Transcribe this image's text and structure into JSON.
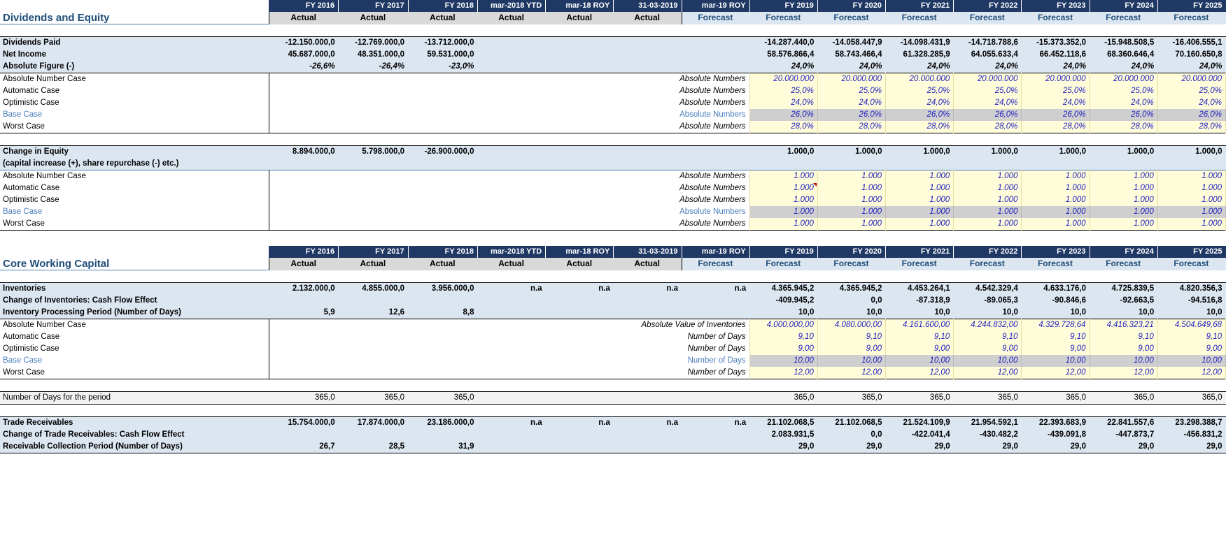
{
  "columns": {
    "years": [
      "FY 2016",
      "FY 2017",
      "FY 2018",
      "mar-2018 YTD",
      "mar-18 ROY",
      "31-03-2019",
      "mar-19 ROY",
      "FY 2019",
      "FY 2020",
      "FY 2021",
      "FY 2022",
      "FY 2023",
      "FY 2024",
      "FY 2025"
    ],
    "types": [
      "Actual",
      "Actual",
      "Actual",
      "Actual",
      "Actual",
      "Actual",
      "Forecast",
      "Forecast",
      "Forecast",
      "Forecast",
      "Forecast",
      "Forecast",
      "Forecast",
      "Forecast"
    ]
  },
  "colors": {
    "header_navy": "#1f3864",
    "actual_grey": "#d9d9d9",
    "forecast_blue": "#dce6f1",
    "accent_text": "#1f4e79",
    "base_case_text": "#4a7ebb",
    "input_yellow": "#fffcd9",
    "input_blue_text": "#1f1fc0",
    "base_case_fill": "#cfcfcf"
  },
  "section1": {
    "title": "Dividends and Equity",
    "rows": [
      {
        "label": "Dividends Paid",
        "values": [
          "-12.150.000,0",
          "-12.769.000,0",
          "-13.712.000,0",
          "",
          "",
          "",
          "",
          "-14.287.440,0",
          "-14.058.447,9",
          "-14.098.431,9",
          "-14.718.788,6",
          "-15.373.352,0",
          "-15.948.508,5",
          "-16.406.555,1"
        ]
      },
      {
        "label": "Net Income",
        "values": [
          "45.687.000,0",
          "48.351.000,0",
          "59.531.000,0",
          "",
          "",
          "",
          "",
          "58.576.866,4",
          "58.743.466,4",
          "61.328.285,9",
          "64.055.633,4",
          "66.452.118,6",
          "68.360.646,4",
          "70.160.650,8"
        ]
      },
      {
        "label": "Absolute Figure (-)",
        "values": [
          "-26,6%",
          "-26,4%",
          "-23,0%",
          "",
          "",
          "",
          "",
          "24,0%",
          "24,0%",
          "24,0%",
          "24,0%",
          "24,0%",
          "24,0%",
          "24,0%"
        ]
      }
    ],
    "scenarios": [
      {
        "name": "Absolute Number Case",
        "unit": "Absolute Numbers",
        "fill": "yellow",
        "values": [
          "20.000.000",
          "20.000.000",
          "20.000.000",
          "20.000.000",
          "20.000.000",
          "20.000.000",
          "20.000.000"
        ]
      },
      {
        "name": "Automatic Case",
        "unit": "Absolute Numbers",
        "fill": "yellow",
        "values": [
          "25,0%",
          "25,0%",
          "25,0%",
          "25,0%",
          "25,0%",
          "25,0%",
          "25,0%"
        ]
      },
      {
        "name": "Optimistic Case",
        "unit": "Absolute Numbers",
        "fill": "yellow",
        "values": [
          "24,0%",
          "24,0%",
          "24,0%",
          "24,0%",
          "24,0%",
          "24,0%",
          "24,0%"
        ]
      },
      {
        "name": "Base Case",
        "unit": "Absolute Numbers",
        "fill": "grey",
        "values": [
          "26,0%",
          "26,0%",
          "26,0%",
          "26,0%",
          "26,0%",
          "26,0%",
          "26,0%"
        ]
      },
      {
        "name": "Worst Case",
        "unit": "Absolute Numbers",
        "fill": "yellow",
        "values": [
          "28,0%",
          "28,0%",
          "28,0%",
          "28,0%",
          "28,0%",
          "28,0%",
          "28,0%"
        ]
      }
    ],
    "equity": {
      "label": "Change in Equity",
      "sublabel": "(capital increase (+), share repurchase (-) etc.)",
      "values": [
        "8.894.000,0",
        "5.798.000,0",
        "-26.900.000,0",
        "",
        "",
        "",
        "",
        "1.000,0",
        "1.000,0",
        "1.000,0",
        "1.000,0",
        "1.000,0",
        "1.000,0",
        "1.000,0"
      ],
      "scenarios": [
        {
          "name": "Absolute Number Case",
          "unit": "Absolute Numbers",
          "fill": "yellow",
          "values": [
            "1.000",
            "1.000",
            "1.000",
            "1.000",
            "1.000",
            "1.000",
            "1.000"
          ]
        },
        {
          "name": "Automatic Case",
          "unit": "Absolute Numbers",
          "fill": "yellow",
          "comment_on": 0,
          "values": [
            "1.000",
            "1.000",
            "1.000",
            "1.000",
            "1.000",
            "1.000",
            "1.000"
          ]
        },
        {
          "name": "Optimistic Case",
          "unit": "Absolute Numbers",
          "fill": "yellow",
          "values": [
            "1.000",
            "1.000",
            "1.000",
            "1.000",
            "1.000",
            "1.000",
            "1.000"
          ]
        },
        {
          "name": "Base Case",
          "unit": "Absolute Numbers",
          "fill": "grey",
          "values": [
            "1.000",
            "1.000",
            "1.000",
            "1.000",
            "1.000",
            "1.000",
            "1.000"
          ]
        },
        {
          "name": "Worst Case",
          "unit": "Absolute Numbers",
          "fill": "yellow",
          "values": [
            "1.000",
            "1.000",
            "1.000",
            "1.000",
            "1.000",
            "1.000",
            "1.000"
          ]
        }
      ]
    }
  },
  "section2": {
    "title": "Core Working Capital",
    "inventories": {
      "rows": [
        {
          "label": "Inventories",
          "values": [
            "2.132.000,0",
            "4.855.000,0",
            "3.956.000,0",
            "n.a",
            "n.a",
            "n.a",
            "n.a",
            "4.365.945,2",
            "4.365.945,2",
            "4.453.264,1",
            "4.542.329,4",
            "4.633.176,0",
            "4.725.839,5",
            "4.820.356,3"
          ]
        },
        {
          "label": "Change of Inventories: Cash Flow Effect",
          "values": [
            "",
            "",
            "",
            "",
            "",
            "",
            "",
            "-409.945,2",
            "0,0",
            "-87.318,9",
            "-89.065,3",
            "-90.846,6",
            "-92.663,5",
            "-94.516,8"
          ]
        },
        {
          "label": "Inventory Processing Period (Number of Days)",
          "values": [
            "5,9",
            "12,6",
            "8,8",
            "",
            "",
            "",
            "",
            "10,0",
            "10,0",
            "10,0",
            "10,0",
            "10,0",
            "10,0",
            "10,0"
          ]
        }
      ],
      "scenarios": [
        {
          "name": "Absolute Number Case",
          "unit": "Absolute Value of Inventories",
          "fill": "yellow",
          "values": [
            "4.000.000,00",
            "4.080.000,00",
            "4.161.600,00",
            "4.244.832,00",
            "4.329.728,64",
            "4.416.323,21",
            "4.504.649,68"
          ]
        },
        {
          "name": "Automatic Case",
          "unit": "Number of Days",
          "fill": "yellow",
          "values": [
            "9,10",
            "9,10",
            "9,10",
            "9,10",
            "9,10",
            "9,10",
            "9,10"
          ]
        },
        {
          "name": "Optimistic Case",
          "unit": "Number of Days",
          "fill": "yellow",
          "values": [
            "9,00",
            "9,00",
            "9,00",
            "9,00",
            "9,00",
            "9,00",
            "9,00"
          ]
        },
        {
          "name": "Base Case",
          "unit": "Number of Days",
          "fill": "grey",
          "values": [
            "10,00",
            "10,00",
            "10,00",
            "10,00",
            "10,00",
            "10,00",
            "10,00"
          ]
        },
        {
          "name": "Worst Case",
          "unit": "Number of Days",
          "fill": "yellow",
          "values": [
            "12,00",
            "12,00",
            "12,00",
            "12,00",
            "12,00",
            "12,00",
            "12,00"
          ]
        }
      ],
      "days_row": {
        "label": "Number of Days for the period",
        "values": [
          "365,0",
          "365,0",
          "365,0",
          "",
          "",
          "",
          "",
          "365,0",
          "365,0",
          "365,0",
          "365,0",
          "365,0",
          "365,0",
          "365,0"
        ]
      }
    },
    "receivables": {
      "rows": [
        {
          "label": "Trade Receivables",
          "values": [
            "15.754.000,0",
            "17.874.000,0",
            "23.186.000,0",
            "n.a",
            "n.a",
            "n.a",
            "n.a",
            "21.102.068,5",
            "21.102.068,5",
            "21.524.109,9",
            "21.954.592,1",
            "22.393.683,9",
            "22.841.557,6",
            "23.298.388,7"
          ]
        },
        {
          "label": "Change of Trade Receivables: Cash Flow Effect",
          "values": [
            "",
            "",
            "",
            "",
            "",
            "",
            "",
            "2.083.931,5",
            "0,0",
            "-422.041,4",
            "-430.482,2",
            "-439.091,8",
            "-447.873,7",
            "-456.831,2"
          ]
        },
        {
          "label": "Receivable Collection Period (Number of Days)",
          "values": [
            "26,7",
            "28,5",
            "31,9",
            "",
            "",
            "",
            "",
            "29,0",
            "29,0",
            "29,0",
            "29,0",
            "29,0",
            "29,0",
            "29,0"
          ]
        }
      ]
    }
  }
}
